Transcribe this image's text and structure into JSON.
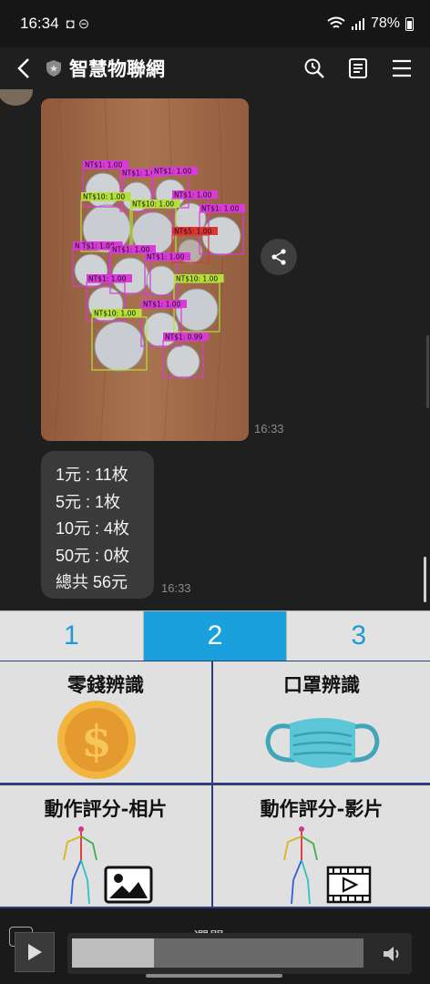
{
  "status": {
    "time": "16:34",
    "notif_icons": "◘ ⊝",
    "battery": "78%"
  },
  "header": {
    "title": "智慧物聯網"
  },
  "chat": {
    "image_timestamp": "16:33",
    "detections": [
      "NT$1: 1.00",
      "NT$1: 1.00",
      "NT$1: 1.00",
      "NT$10: 1.00",
      "NT$1: 1.00",
      "NT$10: 1.00",
      "NT$1: 1.00",
      "NT$5: 1.00",
      "N T$1: 1.00",
      "NT$1: 1.00",
      "NT$1: 1.00",
      "NT$1: 1.00",
      "NT$10: 1.00",
      "NT$1: 1.00",
      "NT$10: 1.00",
      "NT$1: 0.99"
    ],
    "result_lines": [
      "1元 : 11枚",
      "5元 : 1枚",
      "10元 : 4枚",
      "50元 : 0枚",
      "總共 56元"
    ],
    "result_timestamp": "16:33"
  },
  "tabs": [
    "1",
    "2",
    "3"
  ],
  "active_tab": 1,
  "menu": {
    "coin": "零錢辨識",
    "mask": "口罩辨識",
    "action_photo": "動作評分-相片",
    "action_video": "動作評分-影片"
  },
  "bottom": {
    "menu_label": "選單 ▾",
    "media_progress": 0.28
  },
  "colors": {
    "accent": "#1aa0dc",
    "grid_border": "#2c3f7a",
    "coin": "#e8a33a",
    "mask": "#5cc6d6"
  }
}
